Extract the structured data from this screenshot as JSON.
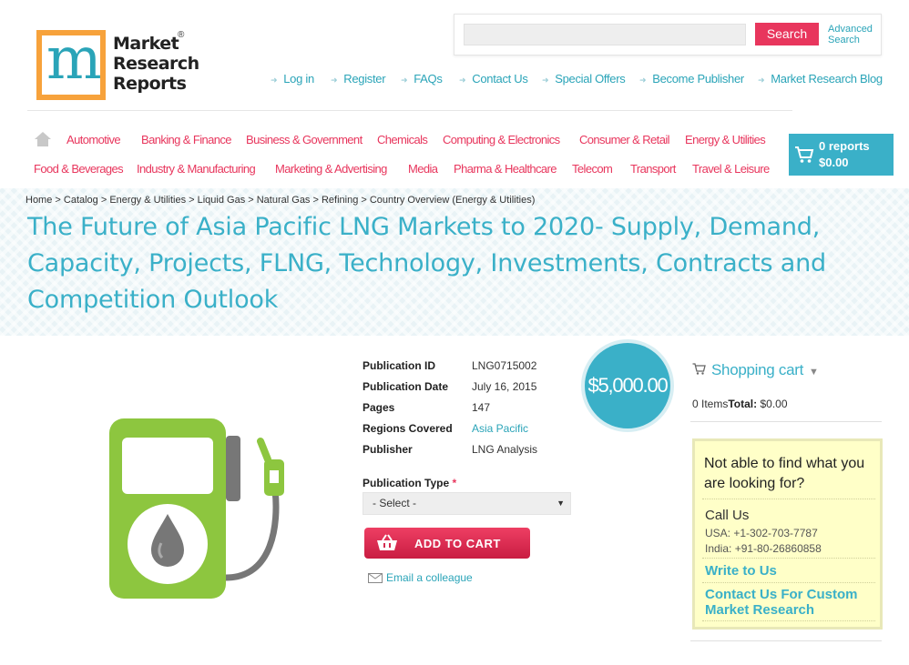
{
  "header": {
    "logo_lines": [
      "Market",
      "Research",
      "Reports"
    ],
    "logo_reg": "®",
    "search_button": "Search",
    "advanced_search": [
      "Advanced",
      "Search"
    ],
    "top_links": [
      "Log in",
      "Register",
      "FAQs",
      "Contact Us",
      "Special Offers",
      "Become Publisher",
      "Market Research Blog"
    ]
  },
  "nav": {
    "row1": [
      "Automotive",
      "Banking & Finance",
      "Business & Government",
      "Chemicals",
      "Computing & Electronics",
      "Consumer & Retail",
      "Energy & Utilities"
    ],
    "row2": [
      "Food & Beverages",
      "Industry & Manufacturing",
      "Marketing & Advertising",
      "Media",
      "Pharma & Healthcare",
      "Telecom",
      "Transport",
      "Travel & Leisure"
    ],
    "cart_reports": "0 reports",
    "cart_total": "$0.00"
  },
  "breadcrumb": "Home > Catalog > Energy & Utilities > Liquid Gas > Natural Gas > Refining > Country Overview (Energy & Utilities)",
  "title": "The Future of Asia Pacific LNG Markets to 2020- Supply, Demand, Capacity, Projects, FLNG, Technology, Investments, Contracts and Competition Outlook",
  "details": {
    "rows": [
      {
        "label": "Publication ID",
        "value": "LNG0715002"
      },
      {
        "label": "Publication Date",
        "value": "July 16, 2015"
      },
      {
        "label": "Pages",
        "value": "147"
      },
      {
        "label": "Regions Covered",
        "value": "Asia Pacific"
      },
      {
        "label": "Publisher",
        "value": "LNG Analysis"
      }
    ],
    "price": "$5,000.00",
    "publication_type_label": "Publication Type",
    "required_mark": "*",
    "select_value": "- Select -",
    "add_to_cart": "ADD TO CART",
    "email_colleague": "Email a colleague"
  },
  "sidebar": {
    "shopping_cart": "Shopping cart",
    "items": "0 Items",
    "total_label": "Total:",
    "total_value": "$0.00",
    "help_question": "Not able to find what you are looking for?",
    "call_us": "Call Us",
    "usa_phone": "USA: +1-302-703-7787",
    "india_phone": "India: +91-80-26860858",
    "write_to_us": "Write to Us",
    "contact_custom": "Contact Us For Custom Market Research"
  },
  "colors": {
    "teal": "#3ab0c8",
    "pink": "#e8365d",
    "pump_green": "#8dc63f",
    "help_bg": "#ffffc8"
  }
}
